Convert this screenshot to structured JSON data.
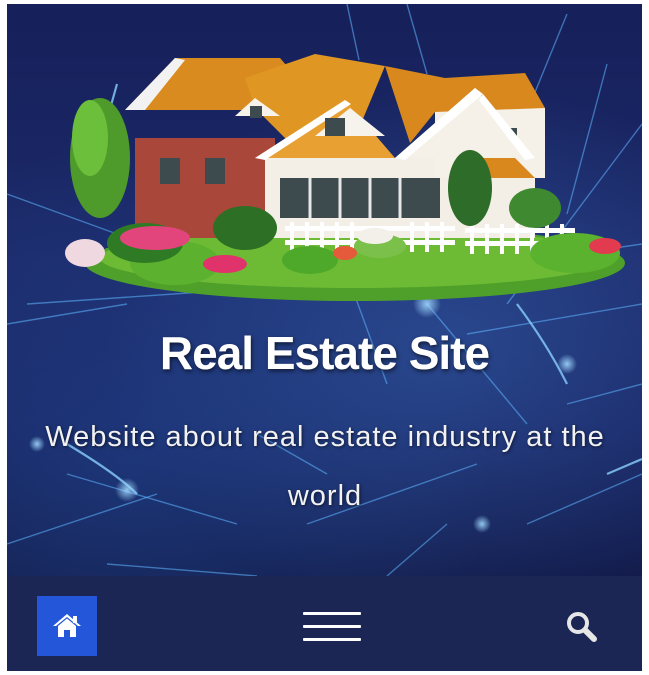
{
  "hero": {
    "title": "Real Estate Site",
    "subtitle": "Website about real estate industry at the world",
    "image": "house-with-garden-illustration"
  },
  "navbar": {
    "home_icon": "home-icon",
    "menu_icon": "hamburger-menu-icon",
    "search_icon": "search-icon"
  },
  "colors": {
    "hero_background": "#1b2560",
    "navbar_background": "#1c2654",
    "home_button": "#2356d8",
    "text": "#ffffff"
  }
}
